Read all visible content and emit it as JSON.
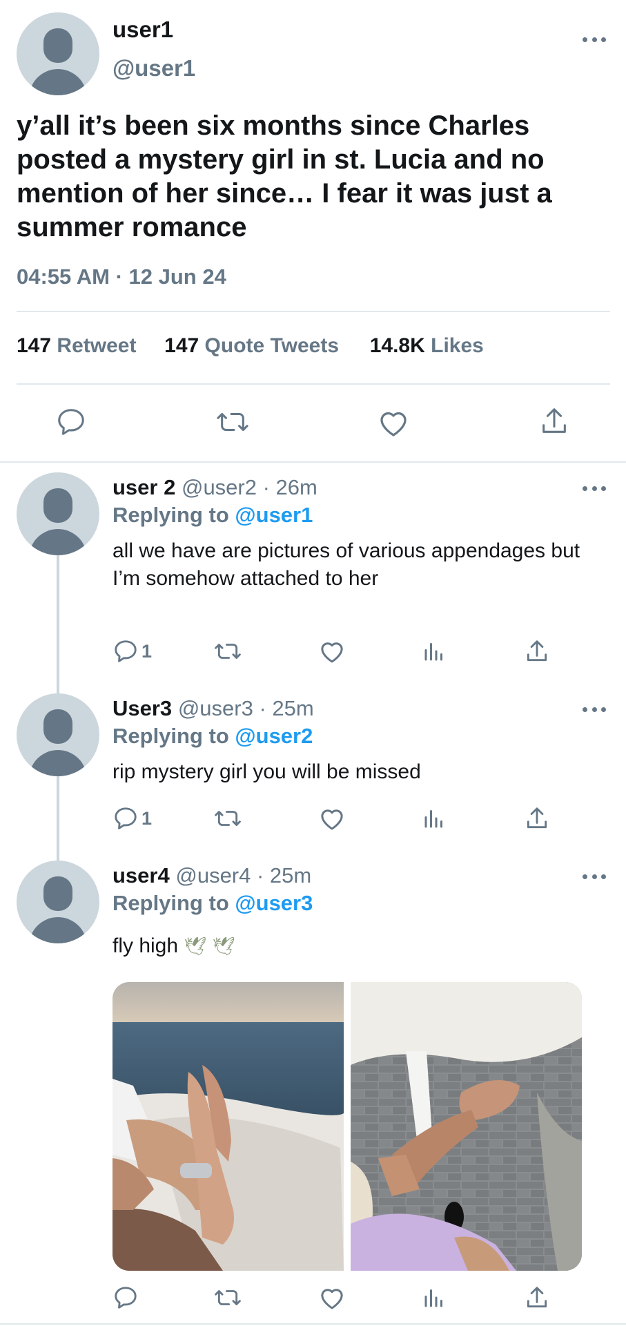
{
  "main_tweet": {
    "name": "user1",
    "handle": "@user1",
    "text": "y’all it’s been six months since Charles posted a mystery girl in st. Lucia and no mention of her since… I fear it was just a summer romance",
    "timestamp": "04:55 AM · 12 Jun 24",
    "stats": {
      "retweet_count": "147",
      "retweet_label": "Retweet",
      "quote_count": "147",
      "quote_label": "Quote Tweets",
      "likes_count": "14.8K",
      "likes_label": "Likes"
    },
    "actions": [
      "reply-icon",
      "retweet-icon",
      "like-icon",
      "share-icon"
    ]
  },
  "replies": [
    {
      "name": "user 2",
      "handle": "@user2 · 26m",
      "replying_prefix": "Replying to",
      "replying_to": "@user1",
      "text": "all we have are pictures of various appendages but I’m somehow attached to her",
      "reply_count": "1"
    },
    {
      "name": "User3",
      "handle": "@user3 · 25m",
      "replying_prefix": "Replying to",
      "replying_to": "@user2",
      "text": "rip mystery girl you will be missed",
      "reply_count": "1"
    },
    {
      "name": "user4",
      "handle": "@user4 · 25m",
      "replying_prefix": "Replying to",
      "replying_to": "@user3",
      "text": "fly high",
      "emoji": "🕊 🕊",
      "reply_count": ""
    }
  ],
  "colors": {
    "accent": "#1d9bf0",
    "muted": "#657786",
    "divider": "#e1e8ed"
  }
}
